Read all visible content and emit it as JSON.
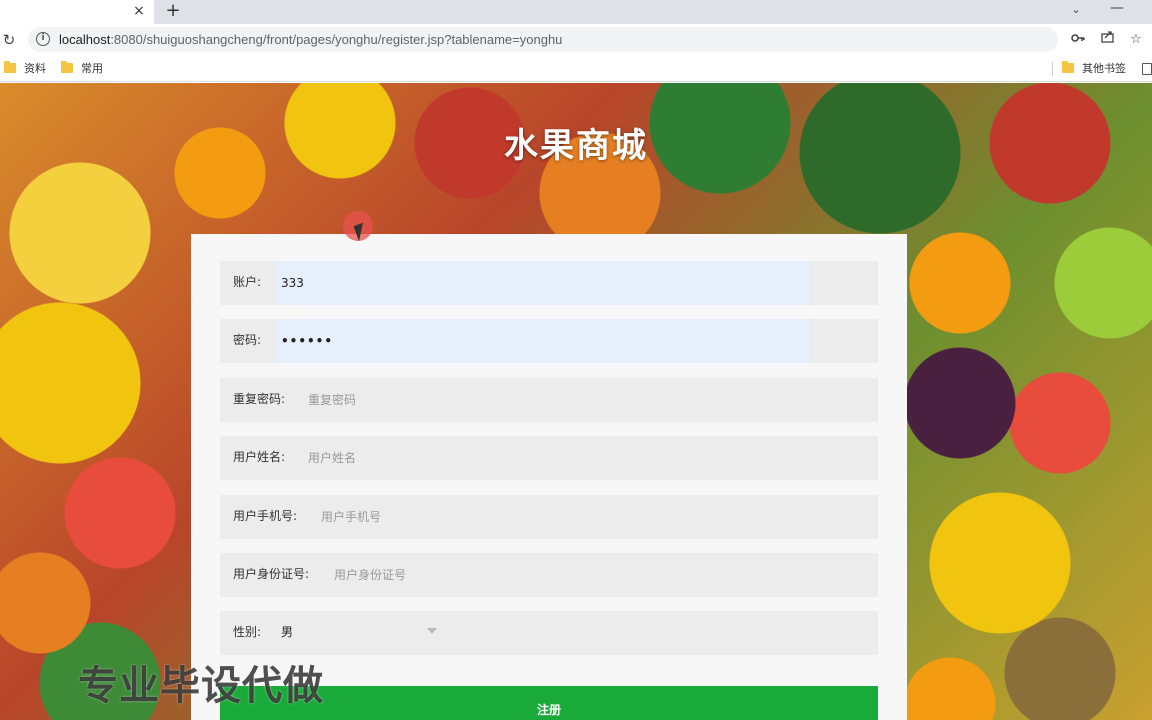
{
  "browser": {
    "tab_close_glyph": "×",
    "new_tab_glyph": "+",
    "url_host": "localhost",
    "url_path": ":8080/shuiguoshangcheng/front/pages/yonghu/register.jsp?tablename=yonghu",
    "bookmarks": [
      "资料",
      "常用"
    ],
    "other_bookmarks": "其他书签"
  },
  "page": {
    "site_title": "水果商城",
    "form": {
      "account": {
        "label": "账户:",
        "value": "333"
      },
      "password": {
        "label": "密码:",
        "value": "••••••"
      },
      "confirm_password": {
        "label": "重复密码:",
        "placeholder": "重复密码"
      },
      "user_name": {
        "label": "用户姓名:",
        "placeholder": "用户姓名"
      },
      "phone": {
        "label": "用户手机号:",
        "placeholder": "用户手机号"
      },
      "id_card": {
        "label": "用户身份证号:",
        "placeholder": "用户身份证号"
      },
      "gender": {
        "label": "性别:",
        "selected": "男"
      },
      "submit_label": "注册"
    },
    "watermark": "专业毕设代做"
  },
  "colors": {
    "submit_bg": "#1aaa3a",
    "autofill_bg": "#e7eefc",
    "cursor_highlight": "#eb5050"
  },
  "icons": [
    "close-icon",
    "plus-icon",
    "chevron-down-icon",
    "minimize-icon",
    "reload-icon",
    "info-icon",
    "key-icon",
    "share-icon",
    "star-icon",
    "folder-icon",
    "reading-list-icon"
  ]
}
